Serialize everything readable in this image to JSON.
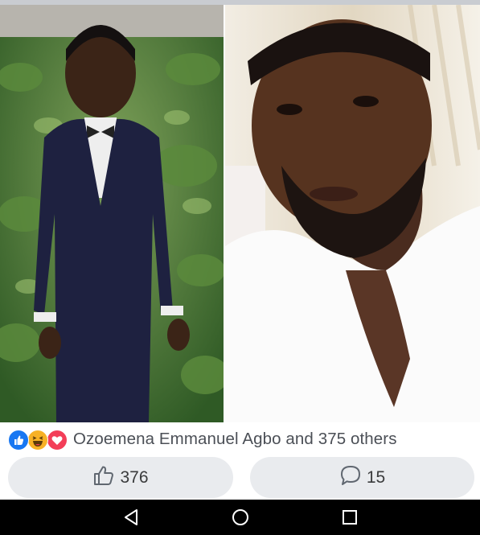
{
  "post": {
    "images": [
      {
        "name": "childhood-photo"
      },
      {
        "name": "adult-photo"
      }
    ]
  },
  "reactions": {
    "icons": [
      "like-icon",
      "haha-icon",
      "love-icon"
    ],
    "summary": "Ozoemena Emmanuel Agbo and 375 others"
  },
  "actions": {
    "like_count": "376",
    "comment_count": "15"
  },
  "navbar": {
    "icons": [
      "back-icon",
      "home-icon",
      "recents-icon"
    ]
  },
  "colors": {
    "like": "#1877f2",
    "haha": "#f7b125",
    "love": "#f33e58",
    "pill_bg": "#e9ebee",
    "navbar": "#000000"
  }
}
